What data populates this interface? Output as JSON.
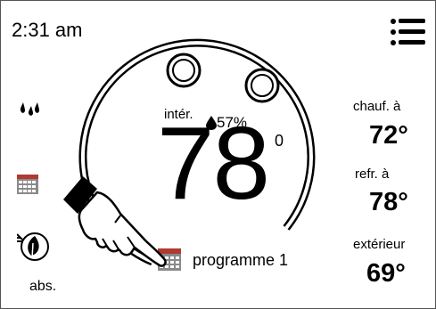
{
  "header": {
    "time": "2:31 am",
    "menu_icon": "hamburger-menu-icon"
  },
  "left": {
    "humidity_icon": "water-drops-icon",
    "schedule_icon": "calendar-icon",
    "away_icon": "leaf-icon",
    "away_label": "abs."
  },
  "center": {
    "location_label": "intér.",
    "humidity": "57%",
    "temperature": "78",
    "temp_mark": "0",
    "program_label": "programme 1"
  },
  "right": {
    "heat_label": "chauf. à",
    "heat_value": "72°",
    "cool_label": "refr. à",
    "cool_value": "78°",
    "outdoor_label": "extérieur",
    "outdoor_value": "69°"
  },
  "colors": {
    "accent": "#000000",
    "handle_fill": "#ffffff",
    "calendar_grid": "#8a8a8a",
    "calendar_header": "#b03a30"
  }
}
